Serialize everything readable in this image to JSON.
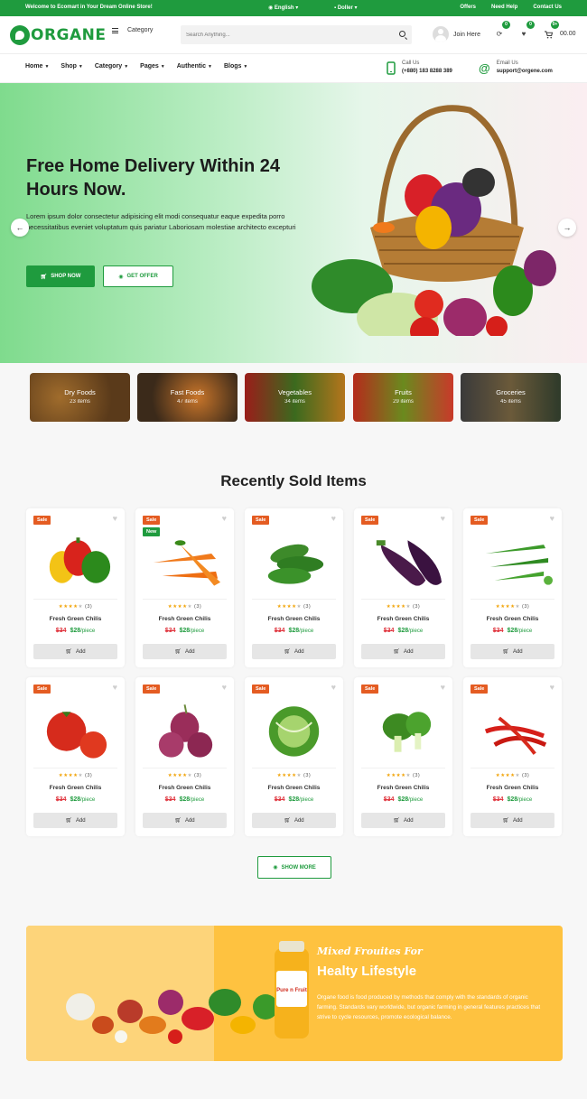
{
  "topbar": {
    "welcome": "Welcome to Ecomart in Your Dream Online Store!",
    "language": "English",
    "currency": "Doller",
    "links": [
      "Offers",
      "Need Help",
      "Contact Us"
    ]
  },
  "header": {
    "logo": "ORGANE",
    "category_label": "Category",
    "search_placeholder": "Search Anything...",
    "join_label": "Join Here",
    "compare_count": "0",
    "wishlist_count": "0",
    "cart_count": "0+",
    "cart_total": "00.00"
  },
  "nav": {
    "items": [
      {
        "label": "Home"
      },
      {
        "label": "Shop"
      },
      {
        "label": "Category"
      },
      {
        "label": "Pages"
      },
      {
        "label": "Authentic"
      },
      {
        "label": "Blogs"
      }
    ],
    "call": {
      "label": "Call Us",
      "value": "(+880) 183 8288 389"
    },
    "email": {
      "label": "Email Us",
      "value": "support@orgene.com"
    }
  },
  "hero": {
    "title": "Free Home Delivery Within 24 Hours Now.",
    "description": "Lorem ipsum dolor consectetur adipisicing elit modi consequatur eaque expedita porro necessitatibus eveniet voluptatum quis pariatur Laboriosam molestiae architecto excepturi",
    "shop_button": "SHOP NOW",
    "offer_button": "GET OFFER"
  },
  "categories": [
    {
      "name": "Dry Foods",
      "count": "23 items"
    },
    {
      "name": "Fast Foods",
      "count": "47 items"
    },
    {
      "name": "Vegetables",
      "count": "34 items"
    },
    {
      "name": "Fruits",
      "count": "29 items"
    },
    {
      "name": "Groceries",
      "count": "45 items"
    }
  ],
  "recent": {
    "title": "Recently Sold Items",
    "show_more": "SHOW MORE",
    "products": [
      {
        "image": "bell-peppers",
        "badge": "Sale",
        "badge2": "",
        "rating_count": "(3)",
        "name": "Fresh Green Chilis",
        "old_price": "$34",
        "new_price": "$28",
        "unit": "/piece",
        "add": "Add"
      },
      {
        "image": "carrots",
        "badge": "Sale",
        "badge2": "New",
        "rating_count": "(3)",
        "name": "Fresh Green Chilis",
        "old_price": "$34",
        "new_price": "$28",
        "unit": "/piece",
        "add": "Add"
      },
      {
        "image": "cucumbers",
        "badge": "Sale",
        "badge2": "",
        "rating_count": "(3)",
        "name": "Fresh Green Chilis",
        "old_price": "$34",
        "new_price": "$28",
        "unit": "/piece",
        "add": "Add"
      },
      {
        "image": "eggplants",
        "badge": "Sale",
        "badge2": "",
        "rating_count": "(3)",
        "name": "Fresh Green Chilis",
        "old_price": "$34",
        "new_price": "$28",
        "unit": "/piece",
        "add": "Add"
      },
      {
        "image": "okra",
        "badge": "Sale",
        "badge2": "",
        "rating_count": "(3)",
        "name": "Fresh Green Chilis",
        "old_price": "$34",
        "new_price": "$28",
        "unit": "/piece",
        "add": "Add"
      },
      {
        "image": "tomatoes",
        "badge": "Sale",
        "badge2": "",
        "rating_count": "(3)",
        "name": "Fresh Green Chilis",
        "old_price": "$34",
        "new_price": "$28",
        "unit": "/piece",
        "add": "Add"
      },
      {
        "image": "red-onions",
        "badge": "Sale",
        "badge2": "",
        "rating_count": "(3)",
        "name": "Fresh Green Chilis",
        "old_price": "$34",
        "new_price": "$28",
        "unit": "/piece",
        "add": "Add"
      },
      {
        "image": "cabbage",
        "badge": "Sale",
        "badge2": "",
        "rating_count": "(3)",
        "name": "Fresh Green Chilis",
        "old_price": "$34",
        "new_price": "$28",
        "unit": "/piece",
        "add": "Add"
      },
      {
        "image": "bok-choy",
        "badge": "Sale",
        "badge2": "",
        "rating_count": "(3)",
        "name": "Fresh Green Chilis",
        "old_price": "$34",
        "new_price": "$28",
        "unit": "/piece",
        "add": "Add"
      },
      {
        "image": "red-chilis",
        "badge": "Sale",
        "badge2": "",
        "rating_count": "(3)",
        "name": "Fresh Green Chilis",
        "old_price": "$34",
        "new_price": "$28",
        "unit": "/piece",
        "add": "Add"
      }
    ]
  },
  "banner": {
    "script_title": "Mixed Frouites For",
    "title": "Healty Lifestyle",
    "description": "Organe food is food produced by methods that comply with the standards of organic farming. Standards vary worldwide, but organic farming in general features practices that strive to cycle resources, promote ecological balance.",
    "bottle_label": "Pure n Fruit"
  },
  "colors": {
    "brand_green": "#1f9b3e",
    "sale_orange": "#e45c22",
    "price_red": "#e0363f",
    "banner_yellow": "#fec240"
  }
}
